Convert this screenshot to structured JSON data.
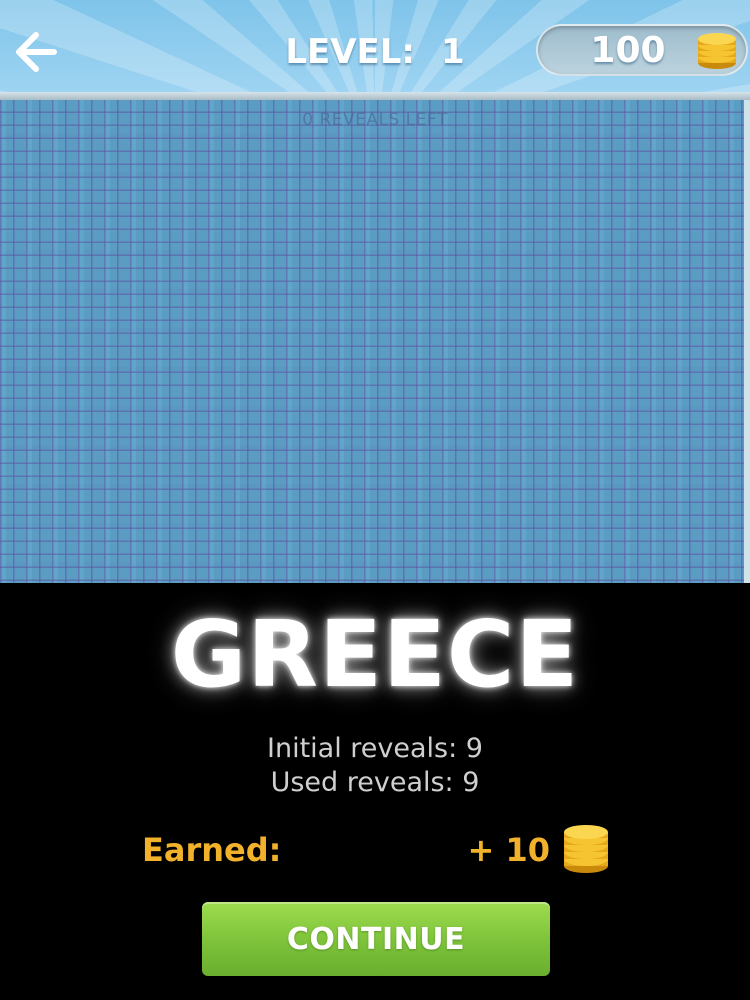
{
  "header": {
    "back_icon": "arrow-left-icon",
    "level_label": "LEVEL:",
    "level_number": "1",
    "coins": "100",
    "coin_icon": "coin-stack-icon"
  },
  "puzzle": {
    "reveals_left_text": "0 REVEALS LEFT"
  },
  "result": {
    "answer": "GREECE",
    "initial_reveals_label": "Initial reveals: 9",
    "used_reveals_label": "Used reveals: 9",
    "earned_label": "Earned:",
    "earned_value": "+ 10",
    "continue_label": "CONTINUE"
  },
  "colors": {
    "header_sky": "#8fcdf0",
    "mosaic_blue": "#5b9cc3",
    "earned_gold": "#f2b12a",
    "continue_green": "#7cc23a"
  }
}
